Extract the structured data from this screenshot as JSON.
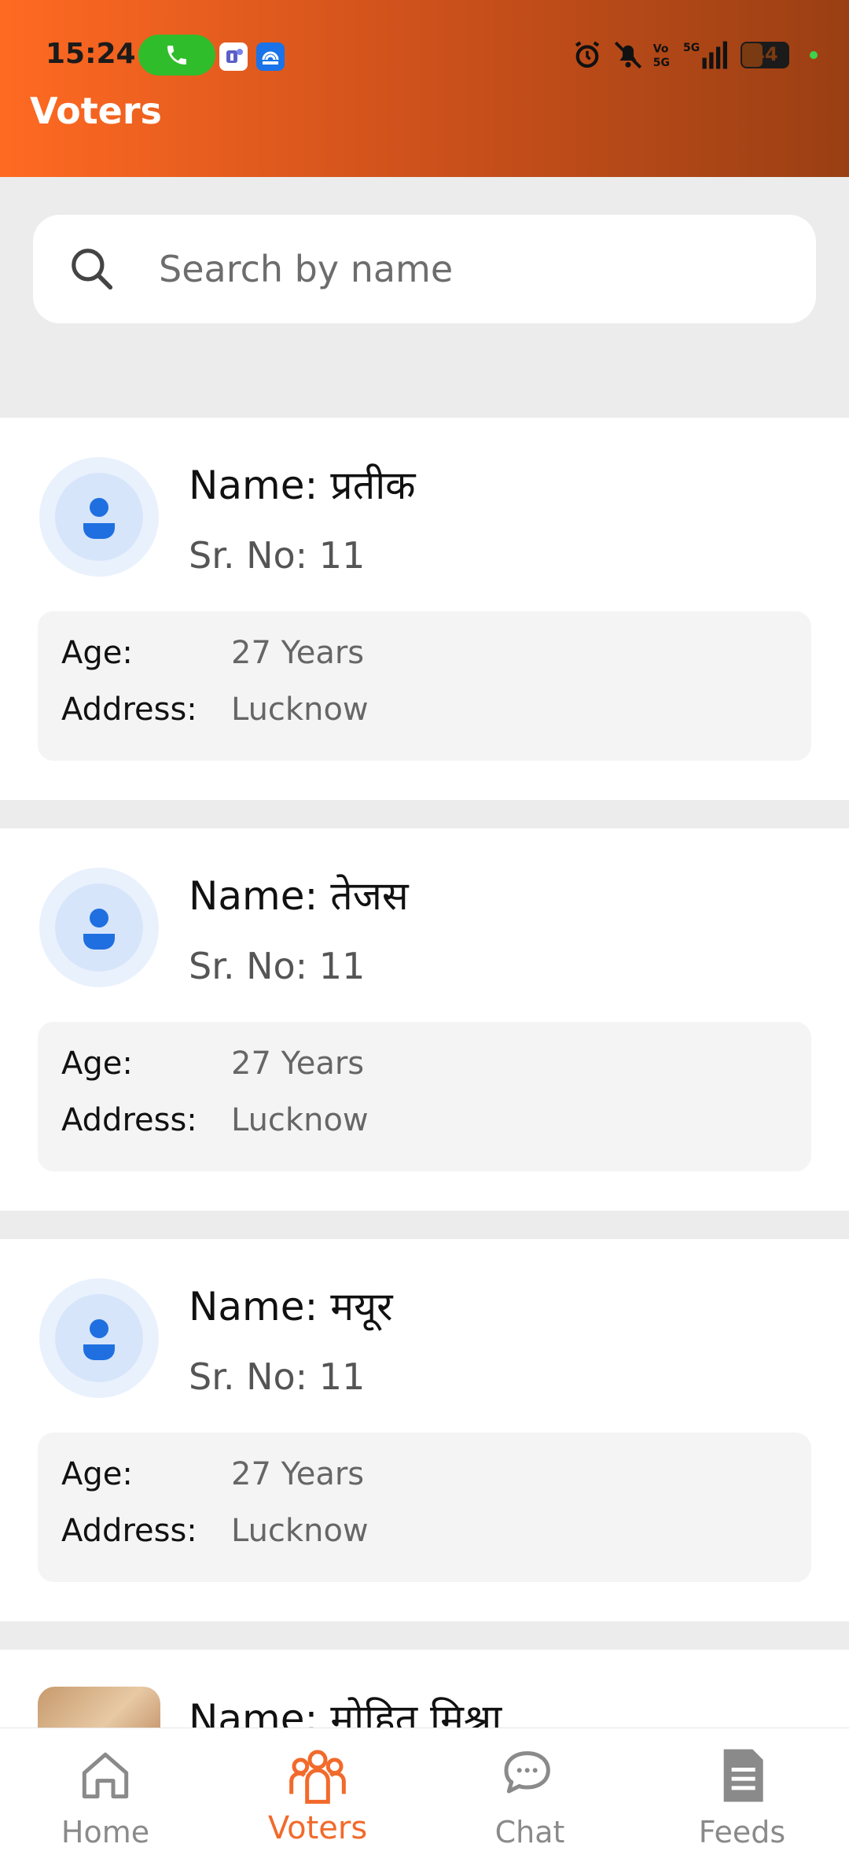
{
  "status_bar": {
    "time": "15:24",
    "icons": [
      "phone-call-icon",
      "teams-app-icon",
      "hotspot-app-icon",
      "alarm-icon",
      "mute-icon",
      "volte-icon",
      "5g-signal-icon",
      "battery-icon"
    ],
    "battery": "44"
  },
  "header": {
    "title": "Voters",
    "gradient": [
      "#ff6a22",
      "#9a3f14"
    ]
  },
  "search": {
    "placeholder": "Search by name"
  },
  "voters": [
    {
      "name": "Name: प्रतीक",
      "sr_no": "Sr. No: 11",
      "age_label": "Age:",
      "age": "27 Years",
      "address_label": "Address:",
      "address": "Lucknow"
    },
    {
      "name": "Name: तेजस",
      "sr_no": "Sr. No: 11",
      "age_label": "Age:",
      "age": "27 Years",
      "address_label": "Address:",
      "address": "Lucknow"
    },
    {
      "name": "Name: मयूर",
      "sr_no": "Sr. No: 11",
      "age_label": "Age:",
      "age": "27 Years",
      "address_label": "Address:",
      "address": "Lucknow"
    },
    {
      "name": "Name: मोहित मिश्रा"
    }
  ],
  "nav": {
    "items": [
      {
        "label": "Home",
        "icon": "home-icon"
      },
      {
        "label": "Voters",
        "icon": "voters-icon",
        "active": true
      },
      {
        "label": "Chat",
        "icon": "chat-icon"
      },
      {
        "label": "Feeds",
        "icon": "feeds-icon"
      }
    ],
    "active_color": "#f26a2b"
  },
  "colors": {
    "avatar_person": "#1f6fe0",
    "accent": "#f26a2b"
  }
}
